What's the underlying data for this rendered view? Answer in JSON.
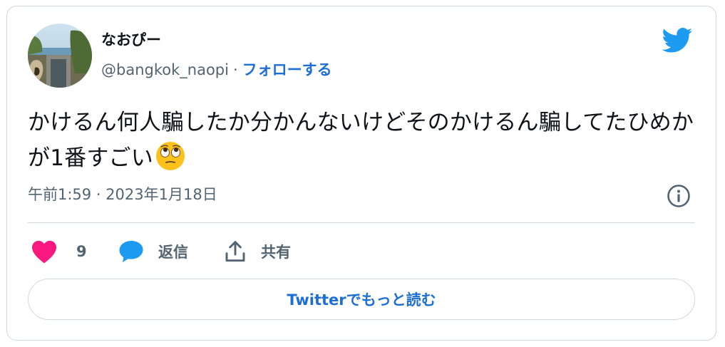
{
  "author": {
    "display_name": "なおぴー",
    "handle": "@bangkok_naopi",
    "separator": "·",
    "follow_label": "フォローする"
  },
  "tweet": {
    "text": "かけるん何人騙したか分かんないけどそのかけるん騙してたひめかが1番すごい",
    "emoji": "face-with-rolling-eyes",
    "timestamp": "午前1:59 · 2023年1月18日"
  },
  "actions": {
    "like_count": "9",
    "reply_label": "返信",
    "share_label": "共有"
  },
  "read_more_label": "Twitterでもっと読む",
  "colors": {
    "accent": "#1d6fd4",
    "twitter_blue": "#1d9bf0",
    "like_pink": "#f91880",
    "secondary_text": "#536471",
    "border": "#cfd9de"
  },
  "icons": [
    "twitter-bird-icon",
    "info-icon",
    "heart-icon",
    "reply-bubble-icon",
    "share-icon",
    "rolling-eyes-emoji"
  ]
}
